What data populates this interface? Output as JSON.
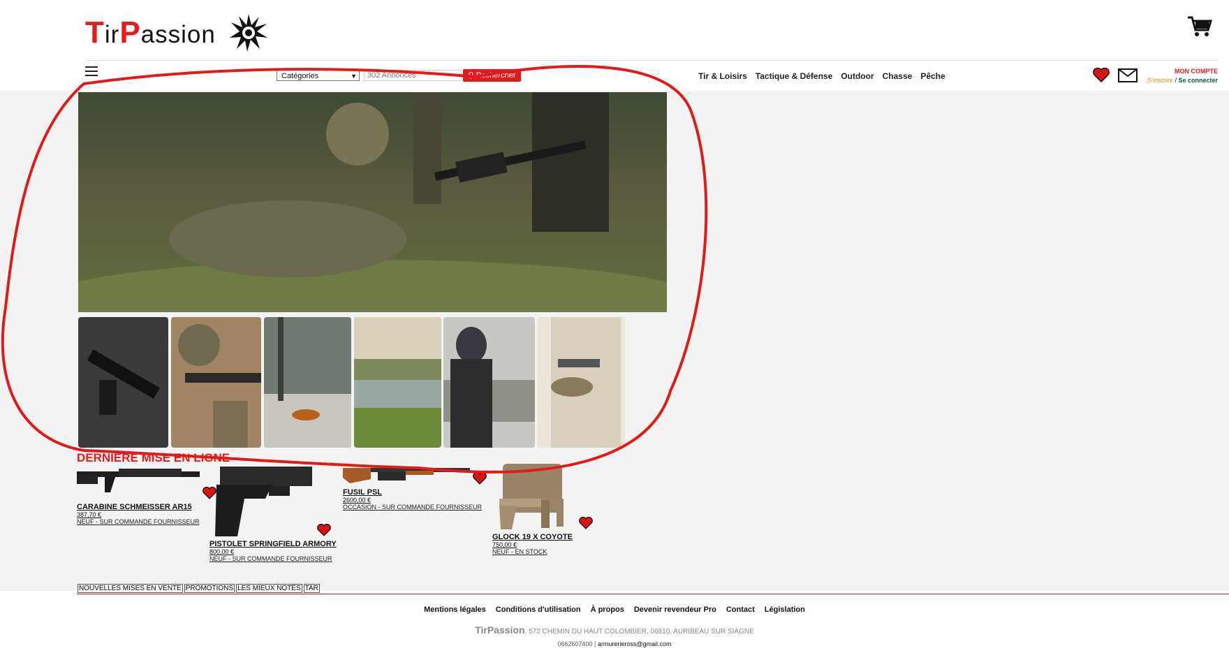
{
  "brand": {
    "logo_T": "T",
    "logo_ir": "ir",
    "logo_P": "P",
    "logo_assion": "assion",
    "accent": "#e31b1b"
  },
  "header": {
    "cart_icon": "cart-icon"
  },
  "nav": {
    "category_select": "Catégories",
    "search_placeholder": "302 Annonces",
    "search_button": "Rechercher",
    "links": [
      "Tir & Loisirs",
      "Tactique & Défense",
      "Outdoor",
      "Chasse",
      "Pêche"
    ],
    "account_title": "MON COMPTE",
    "register": "S'inscrire",
    "separator": "/",
    "login": "Se connecter"
  },
  "latest": {
    "title": "DERNIÈRE MISE EN LIGNE",
    "products": [
      {
        "name": "CARABINE SCHMEISSER AR15",
        "price": "387,70 €",
        "status": "NEUF - SUR COMMANDE FOURNISSEUR"
      },
      {
        "name": "PISTOLET SPRINGFIELD ARMORY",
        "price": "800,00 €",
        "status": "NEUF - SUR COMMANDE FOURNISSEUR"
      },
      {
        "name": "FUSIL PSL",
        "price": "2600,00 €",
        "status": "OCCASION - SUR COMMANDE FOURNISSEUR"
      },
      {
        "name": "GLOCK 19 X COYOTE",
        "price": "750,00 €",
        "status": "NEUF - EN STOCK"
      }
    ],
    "tabs": [
      "NOUVELLES MISES EN VENTE",
      "PROMOTIONS",
      "LES MIEUX NOTÉS",
      "TAR"
    ]
  },
  "footer": {
    "links": [
      "Mentions légales",
      "Conditions d'utilisation",
      "À propos",
      "Devenir revendeur Pro",
      "Contact",
      "Législation"
    ],
    "brand": "TirPassion",
    "address": ", 572 CHEMIN DU HAUT COLOMBIER, 06810, AURIBEAU SUR SIAGNE",
    "phone": "0662607400",
    "sep": " | ",
    "email": "armurerieross@gmail.com"
  }
}
